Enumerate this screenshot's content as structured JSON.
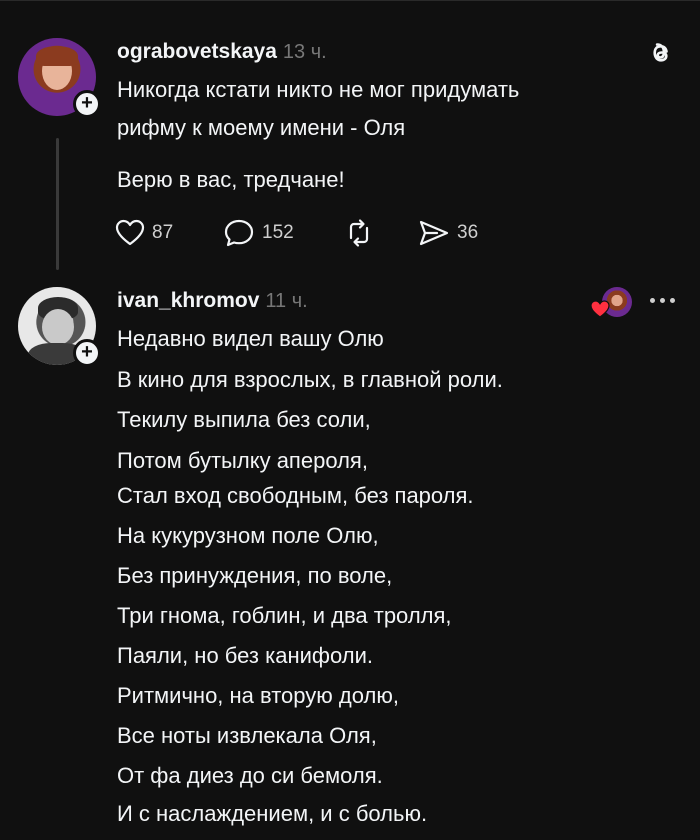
{
  "post1": {
    "author": "ograbovetskaya",
    "time": "13 ч.",
    "lines": [
      "Никогда кстати никто не мог придумать",
      "рифму к моему имени - Оля",
      "Верю в вас, тредчане!"
    ],
    "likes": "87",
    "replies": "152",
    "shares": "36"
  },
  "post2": {
    "author": "ivan_khromov",
    "time": "11 ч.",
    "lines": [
      "Недавно видел вашу Олю",
      "В кино для взрослых, в главной роли.",
      "Текилу выпила без соли,",
      "Потом бутылку апероля,",
      "Стал вход свободным, без пароля.",
      "На кукурузном поле Олю,",
      "Без принуждения, по воле,",
      "Три гнома, гоблин, и два тролля,",
      "Паяли, но без канифоли.",
      "Ритмично, на вторую долю,",
      "Все ноты извлекала Оля,",
      "От фа диез до си бемоля.",
      "И с наслаждением, и с болью."
    ]
  },
  "icons": {
    "like": "heart-icon",
    "reply": "speech-bubble-icon",
    "repost": "repost-icon",
    "share": "send-icon",
    "app": "threads-logo-icon",
    "more": "more-dots-icon"
  },
  "colors": {
    "background": "#101010",
    "text": "#f3f5f7",
    "muted": "#777777",
    "heart": "#ff3040"
  }
}
